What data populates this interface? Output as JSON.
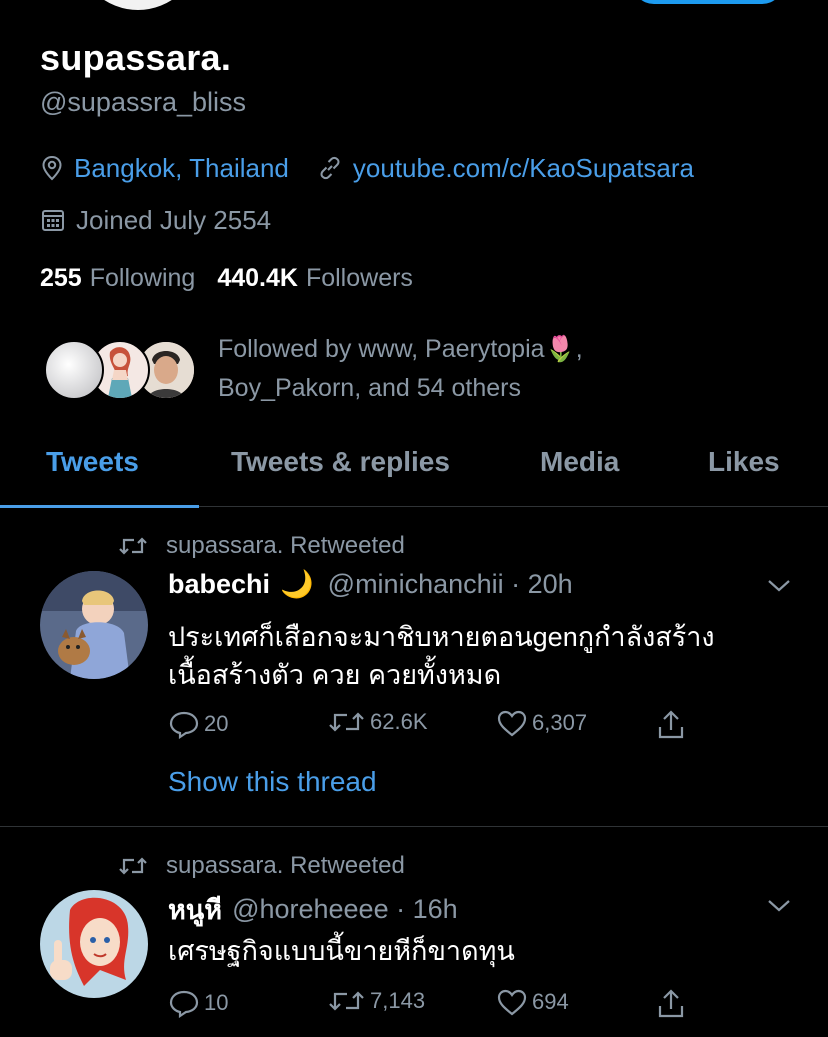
{
  "profile": {
    "display_name": "supassara.",
    "handle": "@supassra_bliss",
    "location": "Bangkok, Thailand",
    "website": "youtube.com/c/KaoSupatsara",
    "joined": "Joined July 2554",
    "following_count": "255",
    "following_label": "Following",
    "followers_count": "440.4K",
    "followers_label": "Followers",
    "followed_by_line1": "Followed by www, Paerytopia",
    "followed_by_emoji": "🌷",
    "followed_by_comma": ",",
    "followed_by_line2": "Boy_Pakorn, and 54 others"
  },
  "tabs": [
    {
      "label": "Tweets"
    },
    {
      "label": "Tweets & replies"
    },
    {
      "label": "Media"
    },
    {
      "label": "Likes"
    }
  ],
  "tweets": [
    {
      "retweet_label": "supassara. Retweeted",
      "name": "babechi",
      "name_emoji": "🌙",
      "handle_time": "@minichanchii · 20h",
      "text_line1": "ประเทศก็เสือกจะมาชิบหายตอนgenกูกำลังสร้าง",
      "text_line2": "เนื้อสร้างตัว ควย ควยทั้งหมด",
      "replies": "20",
      "retweets": "62.6K",
      "likes": "6,307",
      "show_thread": "Show this thread"
    },
    {
      "retweet_label": "supassara. Retweeted",
      "name": "หนูหี",
      "handle_time": "@horeheeee · 16h",
      "text_line1": "เศรษฐกิจแบบนี้ขายหีก็ขาดทุน",
      "replies": "10",
      "retweets": "7,143",
      "likes": "694"
    }
  ],
  "colors": {
    "background": "#000000",
    "accent": "#4a9ee8",
    "muted_text": "#8b98a5",
    "divider": "#2f3336"
  },
  "icons": [
    "location-pin-icon",
    "link-icon",
    "calendar-icon",
    "retweet-icon",
    "reply-icon",
    "like-icon",
    "share-icon",
    "chevron-down-icon"
  ]
}
